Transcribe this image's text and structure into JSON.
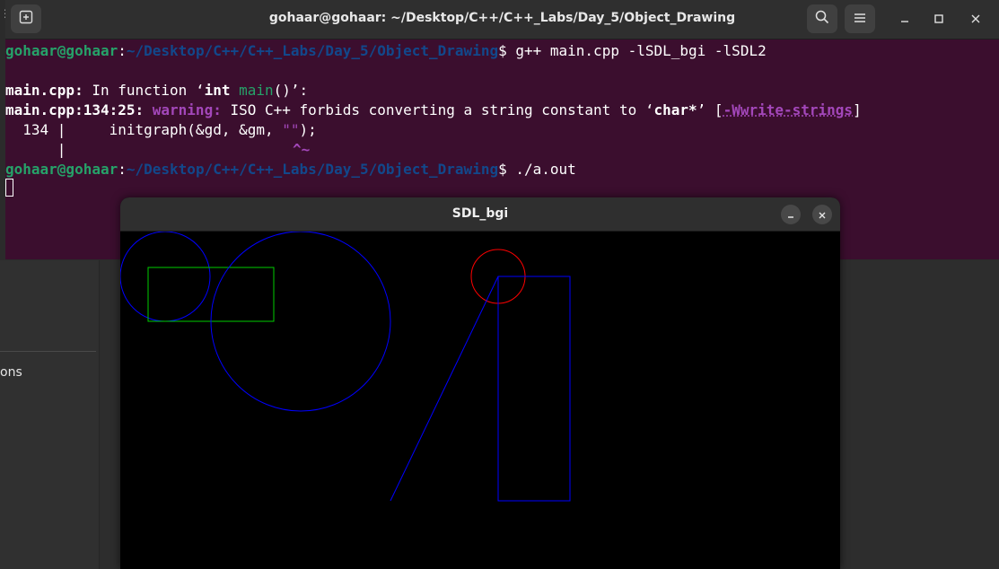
{
  "background": {
    "sidebar_partial_label": "ons"
  },
  "terminal": {
    "title": "gohaar@gohaar: ~/Desktop/C++/C++_Labs/Day_5/Object_Drawing",
    "prompt_user": "gohaar@gohaar",
    "prompt_path": "~/Desktop/C++/C++_Labs/Day_5/Object_Drawing",
    "command1": "g++ main.cpp -lSDL_bgi -lSDL2",
    "diag_file": "main.cpp:",
    "diag_in_function": "In function ‘",
    "diag_type": "int",
    "diag_func": "main",
    "diag_func_end": "()’:",
    "warn_loc": "main.cpp:134:25:",
    "warn_label": "warning:",
    "warn_msg_a": "ISO C++ forbids converting a string constant to ‘",
    "warn_type": "char*",
    "warn_msg_b": "’ [",
    "warn_flag": "-Wwrite-strings",
    "warn_close": "]",
    "code_lineno": "  134 |",
    "code_text_a": "     initgraph(&gd, &gm, ",
    "code_string": "\"\"",
    "code_text_b": ");",
    "caret_gutter": "      |",
    "caret_marker": "^~",
    "command2": "./a.out"
  },
  "sdl_window": {
    "title": "SDL_bgi"
  },
  "colors": {
    "terminal_bg": "#3b0e2e",
    "prompt_green": "#26a269",
    "prompt_blue": "#12488b",
    "warning_purple": "#a347ba",
    "shape_blue": "#0000ff",
    "shape_green": "#00cc00",
    "shape_red": "#ff0000"
  },
  "icons": [
    "new-tab-icon",
    "search-icon",
    "hamburger-menu-icon",
    "minimize-icon",
    "maximize-icon",
    "close-icon"
  ]
}
